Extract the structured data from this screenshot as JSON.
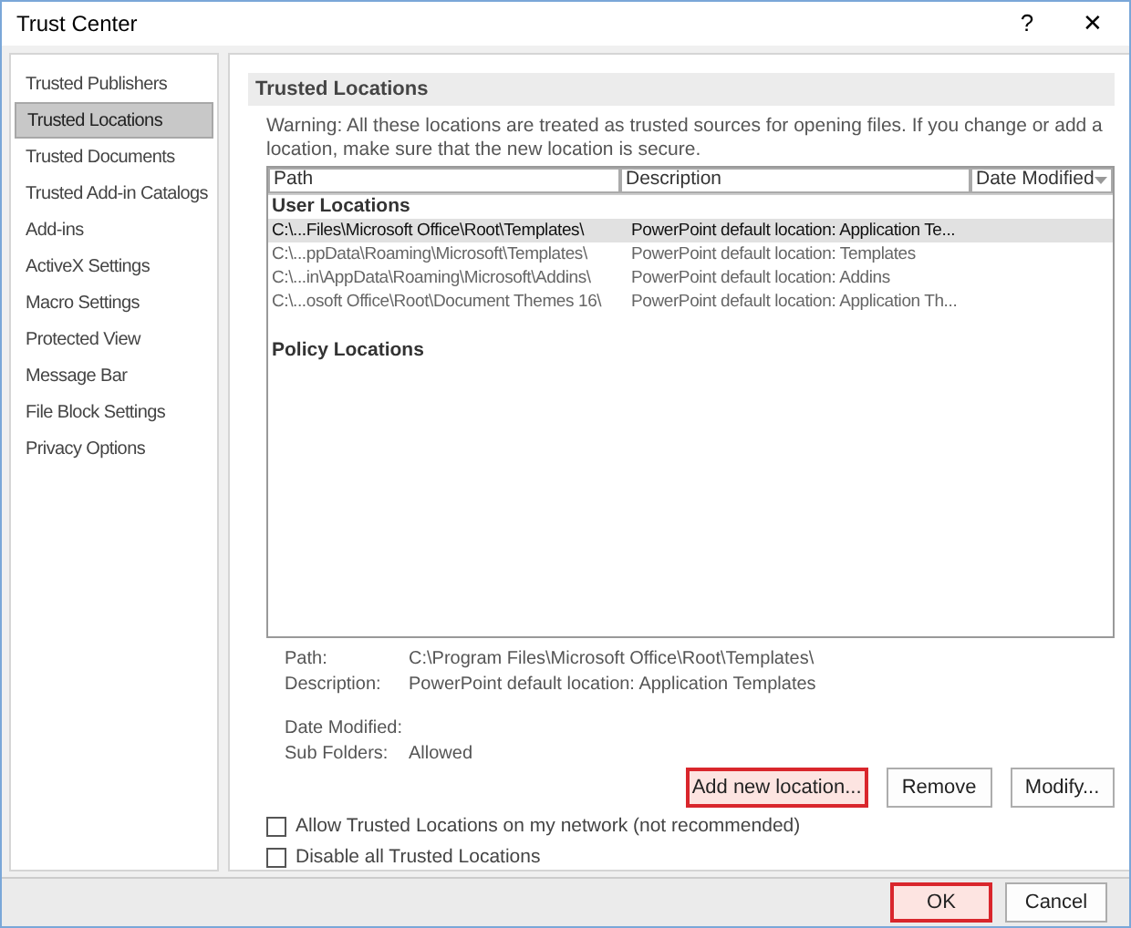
{
  "window": {
    "title": "Trust Center",
    "help": "?",
    "close": "✕"
  },
  "sidebar": {
    "items": [
      {
        "label": "Trusted Publishers",
        "selected": false
      },
      {
        "label": "Trusted Locations",
        "selected": true
      },
      {
        "label": "Trusted Documents",
        "selected": false
      },
      {
        "label": "Trusted Add-in Catalogs",
        "selected": false
      },
      {
        "label": "Add-ins",
        "selected": false
      },
      {
        "label": "ActiveX Settings",
        "selected": false
      },
      {
        "label": "Macro Settings",
        "selected": false
      },
      {
        "label": "Protected View",
        "selected": false
      },
      {
        "label": "Message Bar",
        "selected": false
      },
      {
        "label": "File Block Settings",
        "selected": false
      },
      {
        "label": "Privacy Options",
        "selected": false
      }
    ]
  },
  "section_title": "Trusted Locations",
  "warning": "Warning: All these locations are treated as trusted sources for opening files.  If you change or add a location, make sure that the new location is secure.",
  "table": {
    "columns": [
      "Path",
      "Description",
      "Date Modified"
    ],
    "groups": [
      {
        "title": "User Locations",
        "rows": [
          {
            "path": "C:\\...Files\\Microsoft Office\\Root\\Templates\\",
            "description": "PowerPoint default location: Application Te...",
            "selected": true
          },
          {
            "path": "C:\\...ppData\\Roaming\\Microsoft\\Templates\\",
            "description": "PowerPoint default location: Templates",
            "selected": false
          },
          {
            "path": "C:\\...in\\AppData\\Roaming\\Microsoft\\Addins\\",
            "description": "PowerPoint default location: Addins",
            "selected": false
          },
          {
            "path": "C:\\...osoft Office\\Root\\Document Themes 16\\",
            "description": "PowerPoint default location: Application Th...",
            "selected": false
          }
        ]
      },
      {
        "title": "Policy Locations"
      }
    ]
  },
  "details": [
    {
      "label": "Path:",
      "value": "C:\\Program Files\\Microsoft Office\\Root\\Templates\\"
    },
    {
      "label": "Description:",
      "value": "PowerPoint default location: Application Templates"
    },
    {
      "label": "Date Modified:"
    },
    {
      "label": "Sub Folders:",
      "value": "Allowed"
    }
  ],
  "actions": [
    {
      "label": "Add new location...",
      "highlighted": true
    },
    {
      "label": "Remove",
      "highlighted": false
    },
    {
      "label": "Modify...",
      "highlighted": false
    }
  ],
  "options": [
    {
      "label": "Allow Trusted Locations on my network (not recommended)",
      "checked": false
    },
    {
      "label": "Disable all Trusted Locations",
      "checked": false
    }
  ],
  "footer_buttons": [
    {
      "label": "OK",
      "highlighted": true
    },
    {
      "label": "Cancel",
      "highlighted": false
    }
  ]
}
